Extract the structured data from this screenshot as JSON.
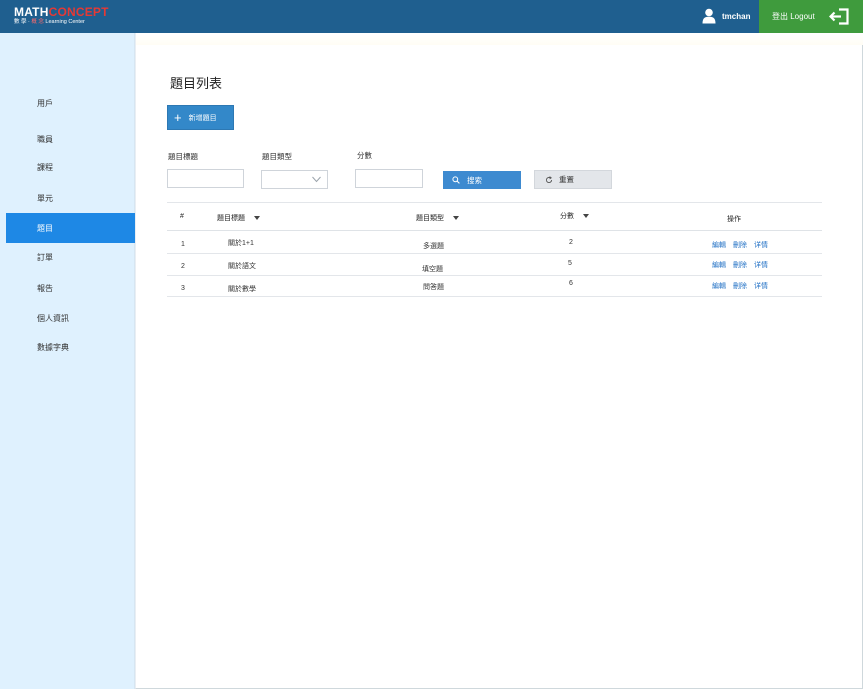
{
  "header": {
    "logo_top_a": "MATH",
    "logo_top_b": "CONCEPT",
    "logo_bottom_a": "數 學 ‧",
    "logo_bottom_b": "概 念",
    "logo_bottom_c": "Learning Center",
    "username": "tmchan",
    "logout_label": "登出 Logout"
  },
  "sidebar": {
    "items": [
      {
        "label": "用戶"
      },
      {
        "label": "職員"
      },
      {
        "label": "課程"
      },
      {
        "label": "單元"
      },
      {
        "label": "題目"
      },
      {
        "label": "訂單"
      },
      {
        "label": "報告"
      },
      {
        "label": "個人資訊"
      },
      {
        "label": "數據字典"
      }
    ],
    "active": "題目"
  },
  "main": {
    "title": "題目列表",
    "add_button": "新增題目",
    "filters": {
      "title_label": "題目標題",
      "type_label": "題目類型",
      "score_label": "分數",
      "search_button": "搜索",
      "reset_button": "重置"
    },
    "table": {
      "headers": {
        "index": "#",
        "title": "題目標題",
        "type": "題目類型",
        "score": "分數",
        "actions": "操作"
      },
      "rows": [
        {
          "index": "1",
          "title": "關於1+1",
          "type": "多選題",
          "score": "2"
        },
        {
          "index": "2",
          "title": "關於語文",
          "type": "填空題",
          "score": "5"
        },
        {
          "index": "3",
          "title": "關於數學",
          "type": "問答題",
          "score": "6"
        }
      ],
      "action_edit": "編輯",
      "action_delete": "刪除",
      "action_detail": "详情"
    }
  },
  "colors": {
    "topbar": "#1f5f8f",
    "logout": "#3f9b3d",
    "sidebar": "#dff1fe",
    "active": "#1e88e5",
    "primary_button": "#3388c9",
    "link": "#1f6fc4"
  }
}
